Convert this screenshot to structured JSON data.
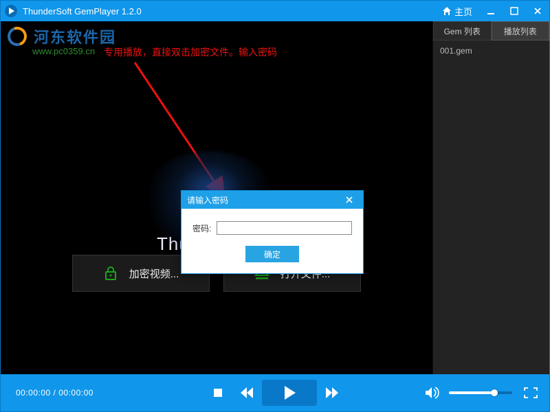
{
  "titlebar": {
    "app_title": "ThunderSoft GemPlayer 1.2.0",
    "home_label": "主页"
  },
  "watermark": {
    "cn_text": "河东软件园",
    "url_text": "www.pc0359.cn"
  },
  "annotation_text": "专用播放，直接双击加密文件。输入密码",
  "splash": {
    "brand_text": "ThunderSoft"
  },
  "big_buttons": {
    "encrypt_label": "加密视频...",
    "open_label": "打开文件..."
  },
  "sidebar": {
    "tabs": [
      "Gem 列表",
      "播放列表"
    ],
    "active_tab_index": 1,
    "items": [
      "001.gem"
    ]
  },
  "controls": {
    "time_current": "00:00:00",
    "time_total": "00:00:00",
    "volume_percent": 72
  },
  "modal": {
    "title": "请输入密码",
    "label": "密码:",
    "ok_label": "确定",
    "input_value": ""
  },
  "colors": {
    "accent": "#1096ea",
    "accent_dark": "#0a78c8",
    "success": "#1aa51a"
  }
}
